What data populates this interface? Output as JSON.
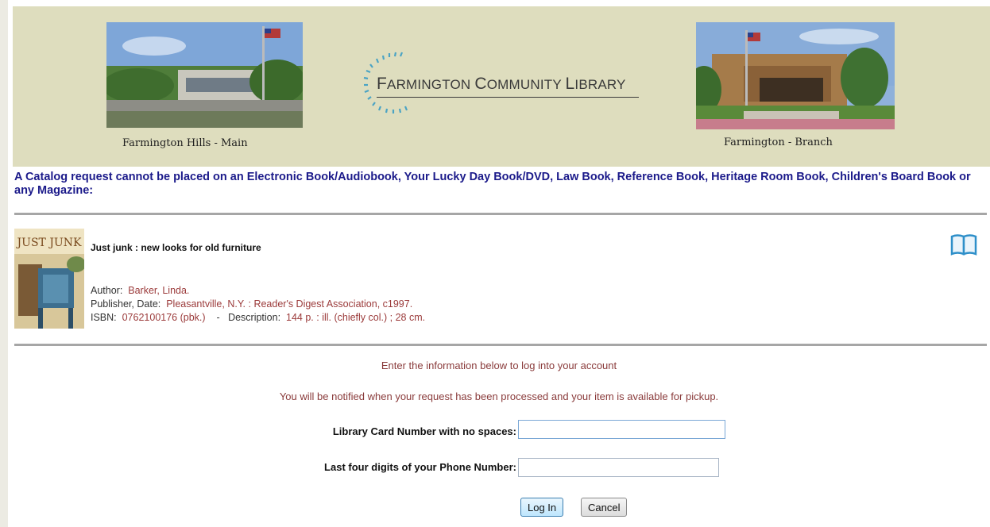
{
  "header": {
    "main_caption": "Farmington Hills - Main",
    "branch_caption": "Farmington - Branch",
    "logo_first_initial": "F",
    "logo_first_rest": "ARMINGTON",
    "logo_second_initial": "C",
    "logo_second_rest": "OMMUNITY",
    "logo_third_initial": "L",
    "logo_third_rest": "IBRARY"
  },
  "notice": "A Catalog request cannot be placed on an Electronic Book/Audiobook, Your Lucky Day Book/DVD, Law Book, Reference Book, Heritage Room Book, Children's Board Book or any Magazine:",
  "item": {
    "cover_title": "JUST JUNK",
    "title": "Just junk : new looks for old furniture",
    "author_label": "Author:",
    "author": "Barker, Linda.",
    "publisher_label": "Publisher, Date:",
    "publisher": "Pleasantville, N.Y. : Reader's Digest Association, c1997.",
    "isbn_label": "ISBN:",
    "isbn": "0762100176 (pbk.)",
    "separator": "-",
    "description_label": "Description:",
    "description": "144 p. : ill. (chiefly col.) ; 28 cm."
  },
  "login": {
    "intro": "Enter the information below to log into your account",
    "notify": "You will be notified when your request has been processed and your item is available for pickup.",
    "card_label": "Library Card Number with no spaces:",
    "card_value": "",
    "phone_label": "Last four digits of your Phone Number:",
    "phone_value": "",
    "login_button": "Log In",
    "cancel_button": "Cancel"
  },
  "colors": {
    "banner_bg": "#deddbe",
    "notice_text": "#1b1a8a",
    "value_text": "#9b3a3a",
    "message_text": "#8a3b3b",
    "icon_blue": "#2e8fc9"
  }
}
